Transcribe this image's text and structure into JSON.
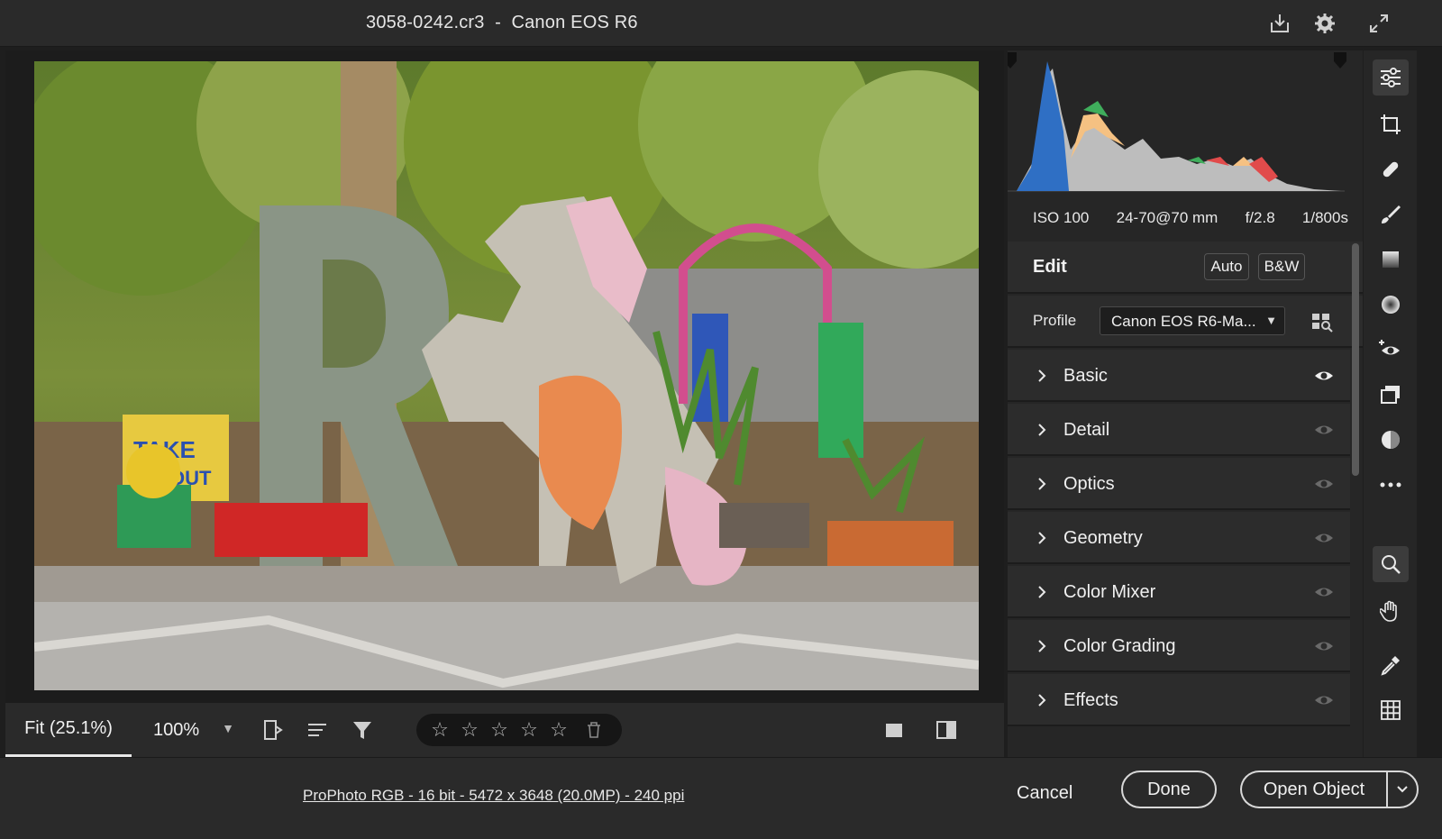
{
  "titlebar": {
    "title": "3058-0242.cr3  -  Canon EOS R6",
    "icons": [
      "save-icon",
      "settings-gear-icon",
      "fullscreen-icon"
    ]
  },
  "image": {
    "description_icon": "photo-preview"
  },
  "bottom_bar": {
    "zoom_fit": "Fit (25.1%)",
    "zoom_100": "100%",
    "stars": [
      "☆",
      "☆",
      "☆",
      "☆",
      "☆"
    ]
  },
  "histogram": {
    "exif": {
      "iso": "ISO 100",
      "lens": "24-70@70 mm",
      "aperture": "f/2.8",
      "shutter": "1/800s"
    }
  },
  "edit": {
    "title": "Edit",
    "auto_label": "Auto",
    "bw_label": "B&W",
    "profile_label": "Profile",
    "profile_value": "Canon EOS R6-Ma...",
    "sections": [
      {
        "label": "Basic",
        "eye_visible": true
      },
      {
        "label": "Detail",
        "eye_visible": false
      },
      {
        "label": "Optics",
        "eye_visible": false
      },
      {
        "label": "Geometry",
        "eye_visible": false
      },
      {
        "label": "Color Mixer",
        "eye_visible": false
      },
      {
        "label": "Color Grading",
        "eye_visible": false
      },
      {
        "label": "Effects",
        "eye_visible": false
      }
    ]
  },
  "footer": {
    "file_info": "ProPhoto RGB - 16 bit - 5472 x 3648 (20.0MP) - 240 ppi",
    "cancel_label": "Cancel",
    "done_label": "Done",
    "open_label": "Open Object"
  },
  "tools": [
    "edit-sliders-icon",
    "crop-icon",
    "healing-icon",
    "brush-icon",
    "gradient-icon",
    "radial-icon",
    "red-eye-icon",
    "snapshots-icon",
    "presets-icon",
    "more-icon",
    "zoom-icon",
    "hand-icon",
    "eyedropper-icon",
    "grid-icon"
  ],
  "colors": {
    "background": "#1e1e1e",
    "panel": "#2c2c2c",
    "text": "#f0f0f0"
  }
}
